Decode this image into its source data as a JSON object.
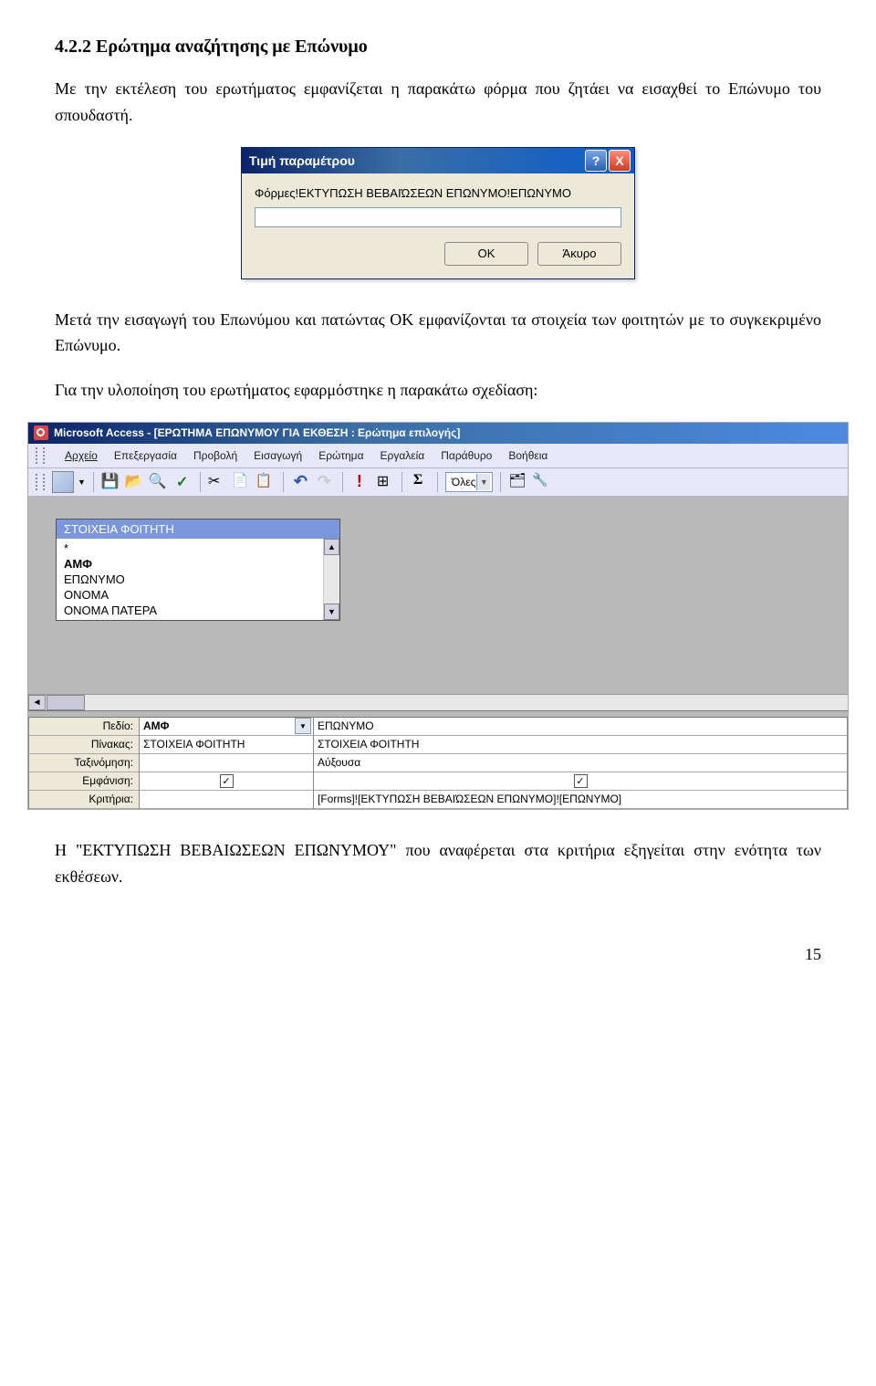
{
  "heading": "4.2.2 Ερώτημα αναζήτησης με Επώνυμο",
  "para1": "Με την εκτέλεση του ερωτήματος εμφανίζεται η παρακάτω φόρμα που ζητάει να εισαχθεί το Επώνυμο του σπουδαστή.",
  "dialog": {
    "title": "Τιμή παραμέτρου",
    "prompt": "Φόρμες!ΕΚΤΥΠΩΣΗ ΒΕΒΑΙΏΣΕΩΝ ΕΠΩΝΥΜΟ!ΕΠΩΝΥΜΟ",
    "ok": "OK",
    "cancel": "Άκυρο",
    "help": "?",
    "close": "X"
  },
  "para2": "Μετά την εισαγωγή του Επωνύμου και πατώντας ΟΚ εμφανίζονται τα στοιχεία των φοιτητών με το συγκεκριμένο Επώνυμο.",
  "para3": "Για την υλοποίηση του ερωτήματος εφαρμόστηκε η παρακάτω σχεδίαση:",
  "access": {
    "title": "Microsoft Access - [ΕΡΩΤΗΜΑ ΕΠΩΝΥΜΟΥ ΓΙΑ ΕΚΘΕΣΗ : Ερώτημα επιλογής]",
    "menus": [
      "Αρχείο",
      "Επεξεργασία",
      "Προβολή",
      "Εισαγωγή",
      "Ερώτημα",
      "Εργαλεία",
      "Παράθυρο",
      "Βοήθεια"
    ],
    "all_label": "Όλες",
    "fieldbox": {
      "title": "ΣΤΟΙΧΕΙΑ ΦΟΙΤΗΤΗ",
      "items": [
        "*",
        "ΑΜΦ",
        "ΕΠΩΝΥΜΟ",
        "ΟΝΟΜΑ",
        "ΟΝΟΜΑ ΠΑΤΕΡΑ"
      ]
    },
    "grid": {
      "labels": [
        "Πεδίο:",
        "Πίνακας:",
        "Ταξινόμηση:",
        "Εμφάνιση:",
        "Κριτήρια:"
      ],
      "col1": {
        "field": "ΑΜΦ",
        "table": "ΣΤΟΙΧΕΙΑ ΦΟΙΤΗΤΗ",
        "sort": "",
        "show": "✓",
        "criteria": ""
      },
      "col2": {
        "field": "ΕΠΩΝΥΜΟ",
        "table": "ΣΤΟΙΧΕΙΑ ΦΟΙΤΗΤΗ",
        "sort": "Αύξουσα",
        "show": "✓",
        "criteria": "[Forms]![ΕΚΤΥΠΩΣΗ ΒΕΒΑΙΏΣΕΩΝ ΕΠΩΝΥΜΟ]![ΕΠΩΝΥΜΟ]"
      }
    }
  },
  "para4_a": "Η \"ΕΚΤΥΠΩΣΗ ΒΕΒΑΙΩΣΕΩΝ ΕΠΩΝΥΜΟΥ\" που αναφέρεται στα κριτήρια εξηγείται στην ενότητα των εκθέσεων.",
  "page_num": "15"
}
